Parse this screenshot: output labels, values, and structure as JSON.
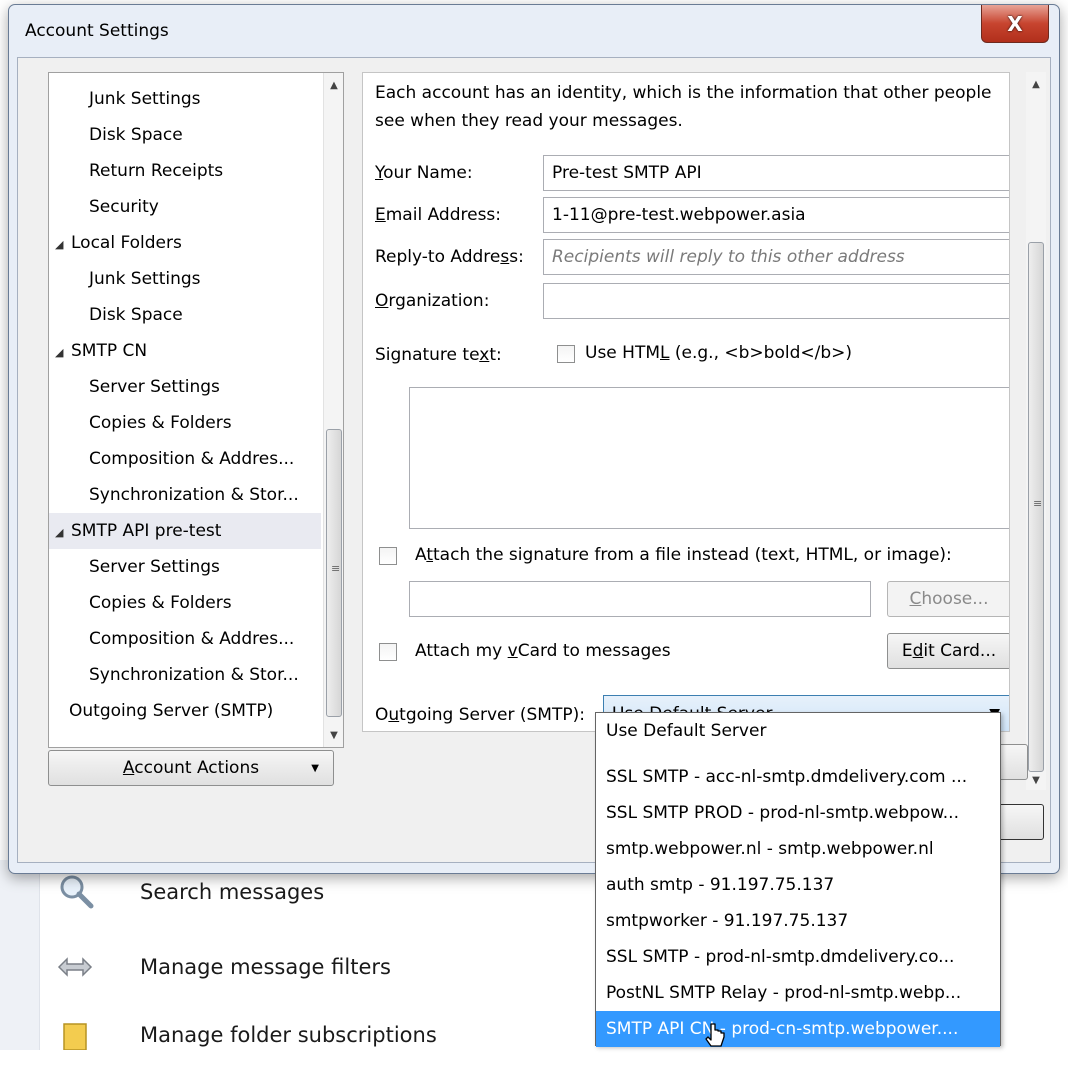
{
  "background": {
    "items": [
      {
        "label": "Search messages",
        "icon": "magnifier-icon"
      },
      {
        "label": "Manage message filters",
        "icon": "filters-icon"
      },
      {
        "label": "Manage folder subscriptions",
        "icon": "folder-icon"
      }
    ]
  },
  "dialog": {
    "title": "Account Settings",
    "close_label": "X"
  },
  "tree": {
    "items": [
      {
        "label": "Junk Settings",
        "level": 1
      },
      {
        "label": "Disk Space",
        "level": 1
      },
      {
        "label": "Return Receipts",
        "level": 1
      },
      {
        "label": "Security",
        "level": 1
      },
      {
        "label": "Local Folders",
        "level": 0
      },
      {
        "label": "Junk Settings",
        "level": 1
      },
      {
        "label": "Disk Space",
        "level": 1
      },
      {
        "label": "SMTP CN",
        "level": 0
      },
      {
        "label": "Server Settings",
        "level": 1
      },
      {
        "label": "Copies & Folders",
        "level": 1
      },
      {
        "label": "Composition & Addres...",
        "level": 1
      },
      {
        "label": "Synchronization & Stor...",
        "level": 1
      },
      {
        "label": "SMTP API pre-test",
        "level": 0
      },
      {
        "label": "Server Settings",
        "level": 1
      },
      {
        "label": "Copies & Folders",
        "level": 1
      },
      {
        "label": "Composition & Addres...",
        "level": 1
      },
      {
        "label": "Synchronization & Stor...",
        "level": 1
      },
      {
        "label": "Outgoing Server (SMTP)",
        "level": 2
      }
    ]
  },
  "account_actions": {
    "label_pre": "",
    "label_u": "A",
    "label_post": "ccount Actions"
  },
  "identity": {
    "intro": "Each account has an identity, which is the information that other people see when they read your messages.",
    "your_name_u": "Y",
    "your_name_rest": "our Name:",
    "your_name_value": "Pre-test SMTP API",
    "email_u": "E",
    "email_rest": "mail Address:",
    "email_value": "1-11@pre-test.webpower.asia",
    "reply_pre": "Reply-to Addre",
    "reply_u": "s",
    "reply_post": "s:",
    "reply_placeholder": "Recipients will reply to this other address",
    "org_u": "O",
    "org_rest": "rganization:",
    "org_value": "",
    "sig_pre": "Signature te",
    "sig_u": "x",
    "sig_post": "t:",
    "use_html_pre": "Use HTM",
    "use_html_u": "L",
    "use_html_post": " (e.g., <b>bold</b>)",
    "attach_sig_pre": "A",
    "attach_sig_u": "t",
    "attach_sig_post": "tach the signature from a file instead (text, HTML, or image):",
    "choose_u": "C",
    "choose_rest": "hoose...",
    "vcard_pre": "Attach my ",
    "vcard_u": "v",
    "vcard_post": "Card to messages",
    "edit_pre": "E",
    "edit_u": "d",
    "edit_post": "it Card...",
    "outgoing_pre": "O",
    "outgoing_u": "u",
    "outgoing_post": "tgoing Server (SMTP):",
    "outgoing_value": "Use Default Server"
  },
  "dropdown": {
    "options": [
      "Use Default Server",
      "SSL SMTP - acc-nl-smtp.dmdelivery.com ...",
      "SSL SMTP PROD - prod-nl-smtp.webpow...",
      "smtp.webpower.nl - smtp.webpower.nl",
      "auth smtp - 91.197.75.137",
      "smtpworker - 91.197.75.137",
      "SSL SMTP - prod-nl-smtp.dmdelivery.co...",
      "PostNL SMTP Relay - prod-nl-smtp.webp...",
      "SMTP API CN - prod-cn-smtp.webpower...."
    ],
    "highlighted_index": 8
  },
  "colors": {
    "highlight": "#3399ff",
    "close_button": "#c7442f"
  }
}
